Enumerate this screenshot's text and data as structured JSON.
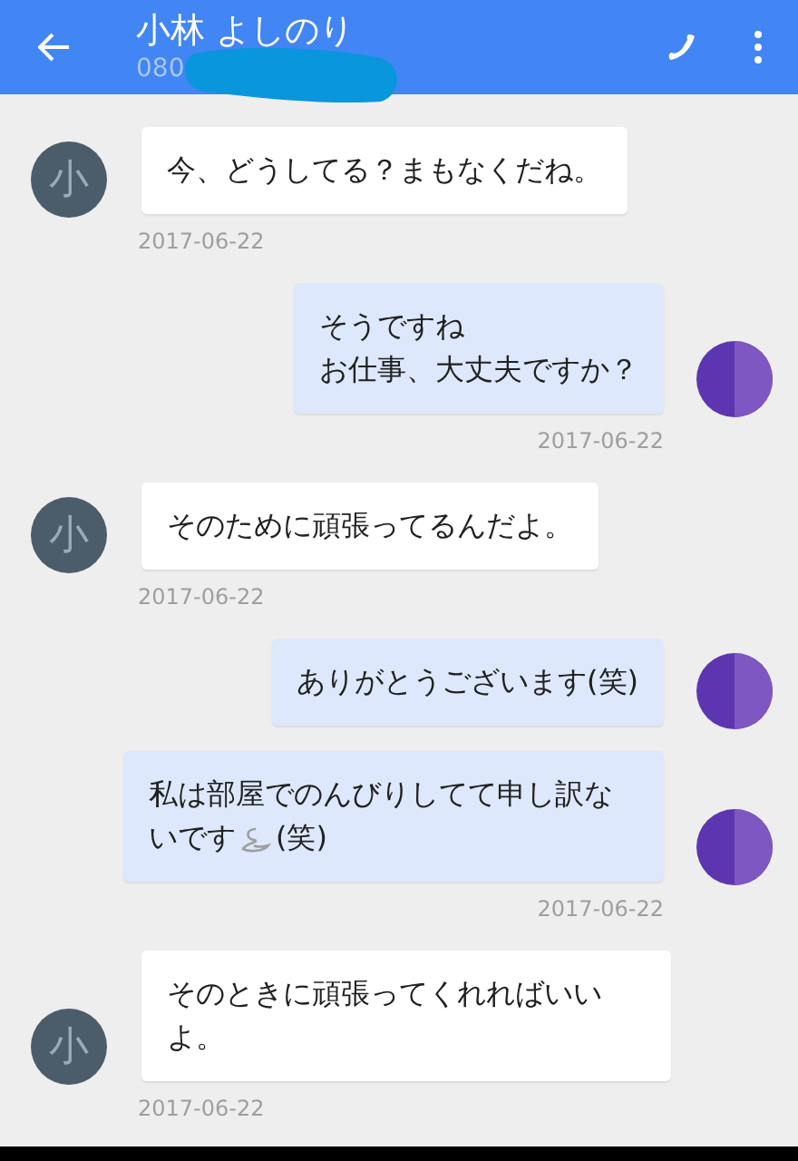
{
  "header": {
    "title": "小林 よしのり",
    "subtitle": "080"
  },
  "messages": [
    {
      "kind": "incoming",
      "avatar_letter": "小",
      "parts": [
        {
          "kind": "text",
          "text": "今、どうしてる？まもなくだね。"
        }
      ],
      "date": "2017-06-22"
    },
    {
      "kind": "outgoing",
      "parts": [
        {
          "kind": "text",
          "text": "そうですね"
        },
        {
          "kind": "break"
        },
        {
          "kind": "text",
          "text": "お仕事、大丈夫ですか？"
        }
      ],
      "date": "2017-06-22"
    },
    {
      "kind": "incoming",
      "avatar_letter": "小",
      "parts": [
        {
          "kind": "text",
          "text": "そのために頑張ってるんだよ。"
        }
      ],
      "date": "2017-06-22"
    },
    {
      "kind": "outgoing",
      "parts": [
        {
          "kind": "text",
          "text": "ありがとうございます(笑)"
        }
      ]
    },
    {
      "kind": "outgoing",
      "parts": [
        {
          "kind": "text",
          "text": "私は部屋でのんびりしてて申し訳ないです"
        },
        {
          "kind": "emoji"
        },
        {
          "kind": "text",
          "text": "(笑)"
        }
      ],
      "date": "2017-06-22"
    },
    {
      "kind": "incoming",
      "avatar_letter": "小",
      "parts": [
        {
          "kind": "text",
          "text": "そのときに頑張ってくれればいいよ。"
        }
      ],
      "date": "2017-06-22"
    }
  ]
}
